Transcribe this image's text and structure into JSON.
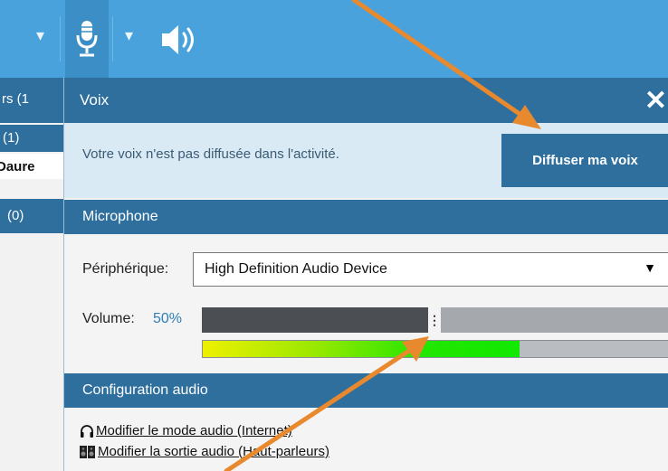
{
  "toolbar": {
    "icons": [
      "chevron-down-icon",
      "microphone-icon",
      "chevron-down-icon",
      "speaker-icon"
    ]
  },
  "left_panel": {
    "row1": "rs (1",
    "row2": "(1)",
    "row3": "Daure",
    "row4": "(0)"
  },
  "dialog": {
    "title": "Voix",
    "close_glyph": "✕",
    "intro_text": "Votre voix n'est pas diffusée dans l'activité.",
    "cast_button": "Diffuser ma voix",
    "microphone_section": "Microphone",
    "device_label": "Périphérique:",
    "device_value": "High Definition Audio Device",
    "volume_label": "Volume:",
    "volume_value": "50%",
    "volume_fraction": 0.5,
    "input_level_fraction": 0.68,
    "audio_section": "Configuration audio",
    "link_mode": "Modifier le mode audio (Internet)",
    "link_output": "Modifier la sortie audio (Haut-parleurs)"
  },
  "colors": {
    "toolbar": "#4aa2dc",
    "header": "#2e6f9e",
    "intro_bg": "#daeaf5",
    "annotation_arrow": "#e8892e"
  }
}
